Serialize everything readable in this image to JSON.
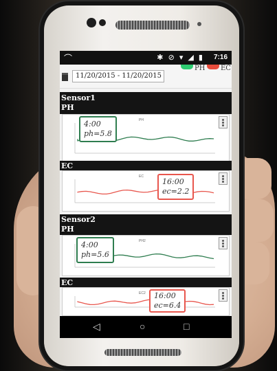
{
  "status_bar": {
    "time": "7:16",
    "icons": "✱ ⊘ ▾ ◢ ▮"
  },
  "date_range": "11/20/2015 - 11/20/2015",
  "legend": [
    {
      "label": "PH",
      "color": "#2ecc71"
    },
    {
      "label": "EC",
      "color": "#e74c3c"
    }
  ],
  "sensors": [
    {
      "name": "Sensor1",
      "charts": [
        {
          "section_label": "PH",
          "chart_title": "PH",
          "tooltip": {
            "time": "4:00",
            "value": "ph=5.8"
          },
          "color": "#2e7d4f"
        },
        {
          "section_label": "EC",
          "chart_title": "EC",
          "tooltip": {
            "time": "16:00",
            "value": "ec=2.2"
          },
          "color": "#e8564d"
        }
      ]
    },
    {
      "name": "Sensor2",
      "charts": [
        {
          "section_label": "PH",
          "chart_title": "PH2",
          "tooltip": {
            "time": "4:00",
            "value": "ph=5.6"
          },
          "color": "#2e7d4f"
        },
        {
          "section_label": "EC",
          "chart_title": "EC2",
          "tooltip": {
            "time": "16:00",
            "value": "ec=6.4"
          },
          "color": "#e8564d"
        }
      ]
    }
  ],
  "nav": {
    "back": "◁",
    "home": "○",
    "recents": "□"
  }
}
